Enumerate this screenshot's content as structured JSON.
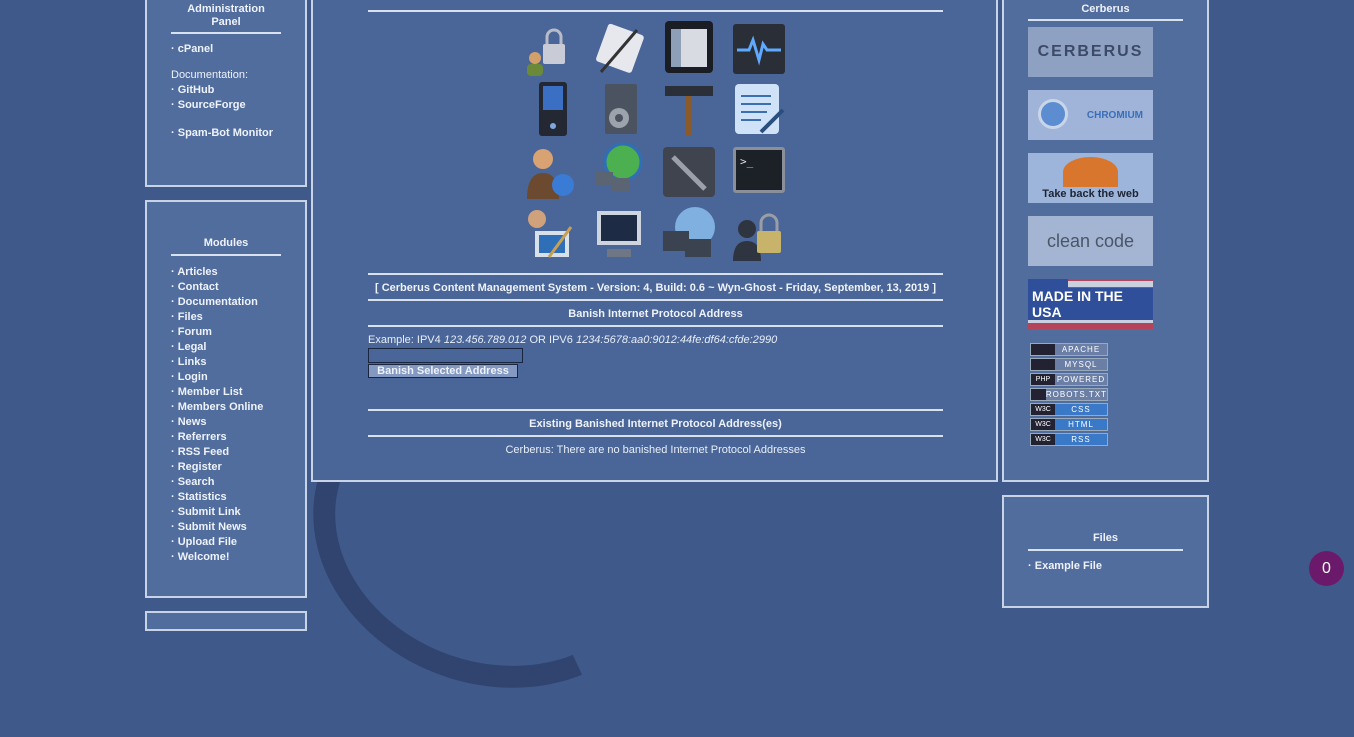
{
  "left_top": {
    "title": "Administration Panel",
    "cpanel": "cPanel",
    "doc_label": "Documentation:",
    "github": "GitHub",
    "sourceforge": "SourceForge",
    "spambot": "Spam-Bot Monitor"
  },
  "modules": {
    "title": "Modules",
    "items": [
      "Articles",
      "Contact",
      "Documentation",
      "Files",
      "Forum",
      "Legal",
      "Links",
      "Login",
      "Member List",
      "Members Online",
      "News",
      "Referrers",
      "RSS Feed",
      "Register",
      "Search",
      "Statistics",
      "Submit Link",
      "Submit News",
      "Upload File",
      "Welcome!"
    ]
  },
  "center": {
    "version": "[ Cerberus Content Management System - Version: 4, Build: 0.6 ~ Wyn-Ghost - Friday, September, 13, 2019 ]",
    "banish_title": "Banish Internet Protocol Address",
    "example_prefix": "Example: IPV4",
    "example_ipv4": "123.456.789.012",
    "example_or": "OR IPV6",
    "example_ipv6": "1234:5678:aa0:9012:44fe:df64:cfde:2990",
    "ip_value": "",
    "banish_button": "Banish Selected Address",
    "existing_title": "Existing Banished Internet Protocol Address(es)",
    "none_msg": "Cerberus: There are no banished Internet Protocol Addresses"
  },
  "right_top": {
    "title": "Cerberus",
    "banners": [
      "CERBERUS",
      "CHROMIUM",
      "Take back the web",
      "clean code",
      "MADE IN THE USA"
    ],
    "badges": [
      {
        "l": "",
        "r": "APACHE"
      },
      {
        "l": "",
        "r": "MYSQL"
      },
      {
        "l": "PHP",
        "r": "POWERED"
      },
      {
        "l": "",
        "r": "ROBOTS.TXT"
      },
      {
        "l": "W3C",
        "r": "CSS"
      },
      {
        "l": "W3C",
        "r": "HTML"
      },
      {
        "l": "W3C",
        "r": "RSS"
      }
    ]
  },
  "files": {
    "title": "Files",
    "item": "Example File"
  },
  "counter": "0",
  "colors": {
    "background": "#3f5a8a",
    "panel": "#516d9e",
    "counter": "#6b1a6b"
  }
}
